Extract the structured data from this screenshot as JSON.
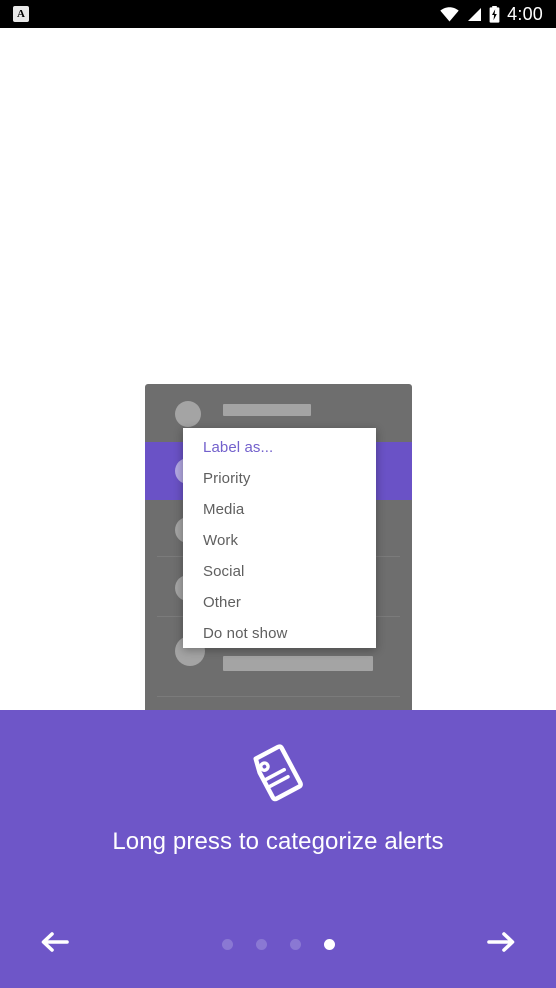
{
  "status_bar": {
    "app_icon": "A",
    "app_icon_name": "notification-app-icon",
    "time": "4:00",
    "icons": [
      "wifi-icon",
      "cell-signal-icon",
      "battery-charging-icon"
    ],
    "background": "#000000"
  },
  "tutorial": {
    "illustration_icon": "tag-icon",
    "caption": "Long press to categorize alerts",
    "accent_color": "#6e56c8",
    "card_color": "#6e6e6e",
    "highlight_color": "#6a52c6"
  },
  "label_menu": {
    "header": "Label as...",
    "header_color": "#7361cc",
    "items": [
      {
        "label": "Priority"
      },
      {
        "label": "Media"
      },
      {
        "label": "Work"
      },
      {
        "label": "Social"
      },
      {
        "label": "Other"
      },
      {
        "label": "Do not show"
      }
    ]
  },
  "navigation": {
    "back_icon": "arrow-left-icon",
    "next_icon": "arrow-right-icon",
    "page_count": 4,
    "current_page": 4,
    "dots": [
      {
        "active": false
      },
      {
        "active": false
      },
      {
        "active": false
      },
      {
        "active": true
      }
    ]
  }
}
